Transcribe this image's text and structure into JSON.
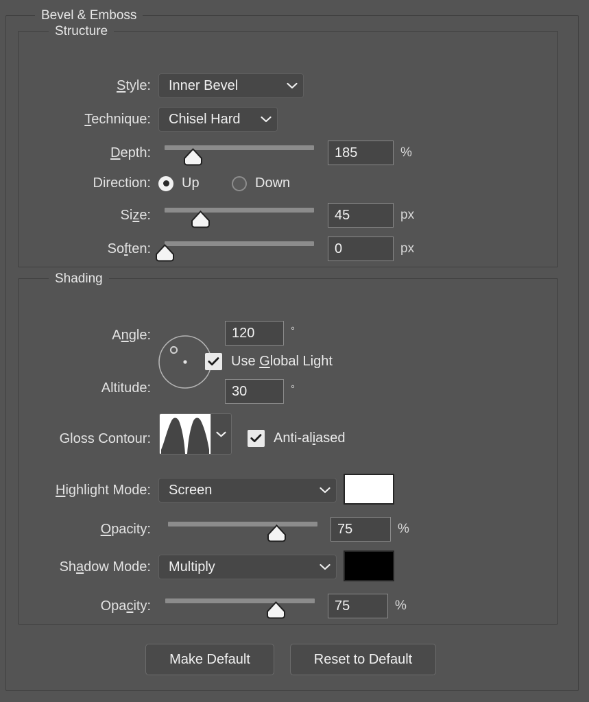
{
  "dialog": {
    "title": "Bevel & Emboss"
  },
  "structure": {
    "title": "Structure",
    "style": {
      "label": "Style:",
      "accel": "S",
      "value": "Inner Bevel"
    },
    "technique": {
      "label": "Technique:",
      "accel": "T",
      "value": "Chisel Hard"
    },
    "depth": {
      "label": "Depth:",
      "accel": "D",
      "value": "185",
      "unit": "%",
      "percent": 19
    },
    "direction": {
      "label": "Direction:",
      "up_label": "Up",
      "down_label": "Down",
      "selected": "Up"
    },
    "size": {
      "label": "Size:",
      "accel": "z",
      "value": "45",
      "unit": "px",
      "percent": 24
    },
    "soften": {
      "label": "Soften:",
      "accel": "f",
      "value": "0",
      "unit": "px",
      "percent": 0
    }
  },
  "shading": {
    "title": "Shading",
    "angle": {
      "label": "Angle:",
      "accel": "n",
      "value": "120",
      "unit": "°",
      "degrees": 120
    },
    "use_global_light": {
      "label": "Use Global Light",
      "accel": "G",
      "checked": true
    },
    "altitude": {
      "label": "Altitude:",
      "value": "30",
      "unit": "°"
    },
    "gloss_contour": {
      "label": "Gloss Contour:",
      "preset": "Ring - Double"
    },
    "anti_aliased": {
      "label": "Anti-aliased",
      "accel": "i",
      "checked": true
    },
    "highlight_mode": {
      "label": "Highlight Mode:",
      "accel": "H",
      "value": "Screen",
      "color": "#ffffff"
    },
    "highlight_opacity": {
      "label": "Opacity:",
      "accel": "O",
      "value": "75",
      "unit": "%",
      "percent": 67
    },
    "shadow_mode": {
      "label": "Shadow Mode:",
      "accel": "a",
      "value": "Multiply",
      "color": "#000000"
    },
    "shadow_opacity": {
      "label": "Opacity:",
      "accel": "c",
      "value": "75",
      "unit": "%",
      "percent": 67
    }
  },
  "footer": {
    "make_default": "Make Default",
    "reset_to_default": "Reset to Default"
  },
  "icons": {
    "chevron_down": "chevron-down-icon",
    "check": "check-icon"
  },
  "colors": {
    "window_background": "#545454",
    "field_background": "#464646",
    "control_background": "#474747",
    "border": "#3f3f3f",
    "text": "#e6e6e6",
    "slider_track": "#8c8c8c",
    "thumb": "#f4f4f4"
  }
}
